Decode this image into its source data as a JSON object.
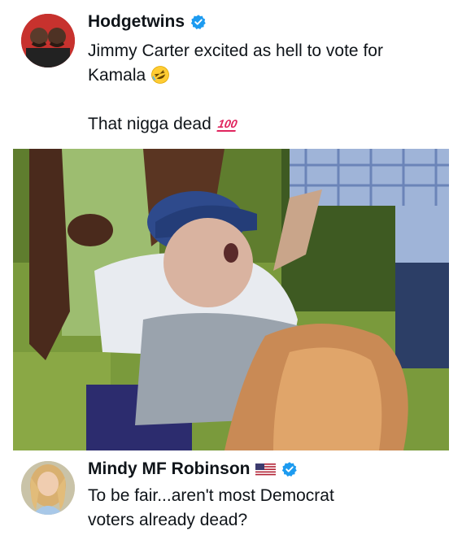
{
  "post_top": {
    "author_name": "Hodgetwins",
    "text_lines": [
      "Jimmy Carter excited as hell to vote for",
      "Kamala",
      "",
      "That nigga dead"
    ],
    "emoji_laughing": "rolling-on-floor-laughing-icon",
    "emoji_hundred": "100",
    "verified": true
  },
  "media": {
    "kind": "image"
  },
  "post_bottom": {
    "author_name": "Mindy MF Robinson",
    "text_lines": [
      "To be fair...aren't most Democrat",
      "voters already dead?"
    ],
    "flag": "us-flag-icon",
    "verified": true
  },
  "colors": {
    "verified_blue": "#1d9bf0",
    "text": "#0f1419",
    "hundred_red": "#e0245e"
  }
}
